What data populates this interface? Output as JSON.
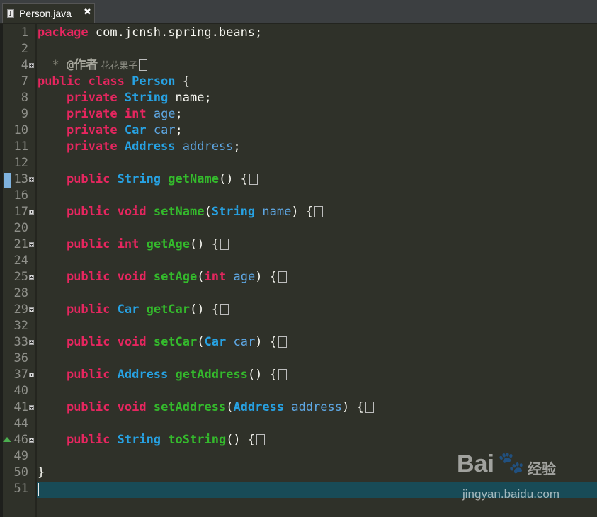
{
  "tab": {
    "file_name": "Person.java",
    "close_symbol": "✖",
    "file_icon_letter": "J"
  },
  "watermark": {
    "brand": "Bai",
    "paw": "🐾",
    "suffix": "经验",
    "url": "jingyan.baidu.com"
  },
  "lines": [
    {
      "num": "1",
      "fold": false,
      "tokens": [
        {
          "t": "package",
          "c": "kw"
        },
        {
          "t": " com.jcnsh.spring.beans;",
          "c": "pl"
        }
      ]
    },
    {
      "num": "2",
      "fold": false,
      "tokens": []
    },
    {
      "num": "4",
      "fold": true,
      "tokens": [
        {
          "t": "  * ",
          "c": "cm"
        },
        {
          "t": "@作者",
          "c": "cmb"
        },
        {
          "t": " 花花果子",
          "c": "cmcn"
        },
        {
          "t": "",
          "c": "box"
        }
      ]
    },
    {
      "num": "7",
      "fold": false,
      "tokens": [
        {
          "t": "public",
          "c": "kw"
        },
        {
          "t": " ",
          "c": "pl"
        },
        {
          "t": "class",
          "c": "kw"
        },
        {
          "t": " ",
          "c": "pl"
        },
        {
          "t": "Person",
          "c": "ty b"
        },
        {
          "t": " {",
          "c": "pl"
        }
      ]
    },
    {
      "num": "8",
      "fold": false,
      "tokens": [
        {
          "t": "    ",
          "c": "pl"
        },
        {
          "t": "private",
          "c": "kw"
        },
        {
          "t": " ",
          "c": "pl"
        },
        {
          "t": "String",
          "c": "ty b"
        },
        {
          "t": " name;",
          "c": "pl"
        }
      ]
    },
    {
      "num": "9",
      "fold": false,
      "tokens": [
        {
          "t": "    ",
          "c": "pl"
        },
        {
          "t": "private",
          "c": "kw"
        },
        {
          "t": " ",
          "c": "pl"
        },
        {
          "t": "int",
          "c": "kw"
        },
        {
          "t": " ",
          "c": "pl"
        },
        {
          "t": "age",
          "c": "var"
        },
        {
          "t": ";",
          "c": "pl"
        }
      ]
    },
    {
      "num": "10",
      "fold": false,
      "tokens": [
        {
          "t": "    ",
          "c": "pl"
        },
        {
          "t": "private",
          "c": "kw"
        },
        {
          "t": " ",
          "c": "pl"
        },
        {
          "t": "Car",
          "c": "ty b"
        },
        {
          "t": " ",
          "c": "pl"
        },
        {
          "t": "car",
          "c": "var"
        },
        {
          "t": ";",
          "c": "pl"
        }
      ]
    },
    {
      "num": "11",
      "fold": false,
      "tokens": [
        {
          "t": "    ",
          "c": "pl"
        },
        {
          "t": "private",
          "c": "kw"
        },
        {
          "t": " ",
          "c": "pl"
        },
        {
          "t": "Address",
          "c": "ty b"
        },
        {
          "t": " ",
          "c": "pl"
        },
        {
          "t": "address",
          "c": "var"
        },
        {
          "t": ";",
          "c": "pl"
        }
      ]
    },
    {
      "num": "12",
      "fold": false,
      "tokens": []
    },
    {
      "num": "13",
      "fold": true,
      "tokens": [
        {
          "t": "    ",
          "c": "pl"
        },
        {
          "t": "public",
          "c": "kw"
        },
        {
          "t": " ",
          "c": "pl"
        },
        {
          "t": "String",
          "c": "ty b"
        },
        {
          "t": " ",
          "c": "pl"
        },
        {
          "t": "getName",
          "c": "fn"
        },
        {
          "t": "() {",
          "c": "pl"
        },
        {
          "t": "",
          "c": "box"
        }
      ]
    },
    {
      "num": "16",
      "fold": false,
      "tokens": []
    },
    {
      "num": "17",
      "fold": true,
      "tokens": [
        {
          "t": "    ",
          "c": "pl"
        },
        {
          "t": "public",
          "c": "kw"
        },
        {
          "t": " ",
          "c": "pl"
        },
        {
          "t": "void",
          "c": "kw"
        },
        {
          "t": " ",
          "c": "pl"
        },
        {
          "t": "setName",
          "c": "fn"
        },
        {
          "t": "(",
          "c": "pl"
        },
        {
          "t": "String",
          "c": "ty b"
        },
        {
          "t": " ",
          "c": "pl"
        },
        {
          "t": "name",
          "c": "var"
        },
        {
          "t": ") {",
          "c": "pl"
        },
        {
          "t": "",
          "c": "box"
        }
      ]
    },
    {
      "num": "20",
      "fold": false,
      "tokens": []
    },
    {
      "num": "21",
      "fold": true,
      "tokens": [
        {
          "t": "    ",
          "c": "pl"
        },
        {
          "t": "public",
          "c": "kw"
        },
        {
          "t": " ",
          "c": "pl"
        },
        {
          "t": "int",
          "c": "kw"
        },
        {
          "t": " ",
          "c": "pl"
        },
        {
          "t": "getAge",
          "c": "fn"
        },
        {
          "t": "() {",
          "c": "pl"
        },
        {
          "t": "",
          "c": "box"
        }
      ]
    },
    {
      "num": "24",
      "fold": false,
      "tokens": []
    },
    {
      "num": "25",
      "fold": true,
      "tokens": [
        {
          "t": "    ",
          "c": "pl"
        },
        {
          "t": "public",
          "c": "kw"
        },
        {
          "t": " ",
          "c": "pl"
        },
        {
          "t": "void",
          "c": "kw"
        },
        {
          "t": " ",
          "c": "pl"
        },
        {
          "t": "setAge",
          "c": "fn"
        },
        {
          "t": "(",
          "c": "pl"
        },
        {
          "t": "int",
          "c": "kw"
        },
        {
          "t": " ",
          "c": "pl"
        },
        {
          "t": "age",
          "c": "var"
        },
        {
          "t": ") {",
          "c": "pl"
        },
        {
          "t": "",
          "c": "box"
        }
      ]
    },
    {
      "num": "28",
      "fold": false,
      "tokens": []
    },
    {
      "num": "29",
      "fold": true,
      "tokens": [
        {
          "t": "    ",
          "c": "pl"
        },
        {
          "t": "public",
          "c": "kw"
        },
        {
          "t": " ",
          "c": "pl"
        },
        {
          "t": "Car",
          "c": "ty b"
        },
        {
          "t": " ",
          "c": "pl"
        },
        {
          "t": "getCar",
          "c": "fn"
        },
        {
          "t": "() {",
          "c": "pl"
        },
        {
          "t": "",
          "c": "box"
        }
      ]
    },
    {
      "num": "32",
      "fold": false,
      "tokens": []
    },
    {
      "num": "33",
      "fold": true,
      "tokens": [
        {
          "t": "    ",
          "c": "pl"
        },
        {
          "t": "public",
          "c": "kw"
        },
        {
          "t": " ",
          "c": "pl"
        },
        {
          "t": "void",
          "c": "kw"
        },
        {
          "t": " ",
          "c": "pl"
        },
        {
          "t": "setCar",
          "c": "fn"
        },
        {
          "t": "(",
          "c": "pl"
        },
        {
          "t": "Car",
          "c": "ty b"
        },
        {
          "t": " ",
          "c": "pl"
        },
        {
          "t": "car",
          "c": "var"
        },
        {
          "t": ") {",
          "c": "pl"
        },
        {
          "t": "",
          "c": "box"
        }
      ]
    },
    {
      "num": "36",
      "fold": false,
      "tokens": []
    },
    {
      "num": "37",
      "fold": true,
      "tokens": [
        {
          "t": "    ",
          "c": "pl"
        },
        {
          "t": "public",
          "c": "kw"
        },
        {
          "t": " ",
          "c": "pl"
        },
        {
          "t": "Address",
          "c": "ty b"
        },
        {
          "t": " ",
          "c": "pl"
        },
        {
          "t": "getAddress",
          "c": "fn"
        },
        {
          "t": "() {",
          "c": "pl"
        },
        {
          "t": "",
          "c": "box"
        }
      ]
    },
    {
      "num": "40",
      "fold": false,
      "tokens": []
    },
    {
      "num": "41",
      "fold": true,
      "tokens": [
        {
          "t": "    ",
          "c": "pl"
        },
        {
          "t": "public",
          "c": "kw"
        },
        {
          "t": " ",
          "c": "pl"
        },
        {
          "t": "void",
          "c": "kw"
        },
        {
          "t": " ",
          "c": "pl"
        },
        {
          "t": "setAddress",
          "c": "fn"
        },
        {
          "t": "(",
          "c": "pl"
        },
        {
          "t": "Address",
          "c": "ty b"
        },
        {
          "t": " ",
          "c": "pl"
        },
        {
          "t": "address",
          "c": "var"
        },
        {
          "t": ") {",
          "c": "pl"
        },
        {
          "t": "",
          "c": "box"
        }
      ]
    },
    {
      "num": "44",
      "fold": false,
      "tokens": []
    },
    {
      "num": "46",
      "fold": true,
      "tokens": [
        {
          "t": "    ",
          "c": "pl"
        },
        {
          "t": "public",
          "c": "kw"
        },
        {
          "t": " ",
          "c": "pl"
        },
        {
          "t": "String",
          "c": "ty b"
        },
        {
          "t": " ",
          "c": "pl"
        },
        {
          "t": "toString",
          "c": "fn"
        },
        {
          "t": "() {",
          "c": "pl"
        },
        {
          "t": "",
          "c": "box"
        }
      ]
    },
    {
      "num": "49",
      "fold": false,
      "tokens": []
    },
    {
      "num": "50",
      "fold": false,
      "tokens": [
        {
          "t": "}",
          "c": "pl"
        }
      ]
    },
    {
      "num": "51",
      "fold": false,
      "tokens": []
    }
  ]
}
